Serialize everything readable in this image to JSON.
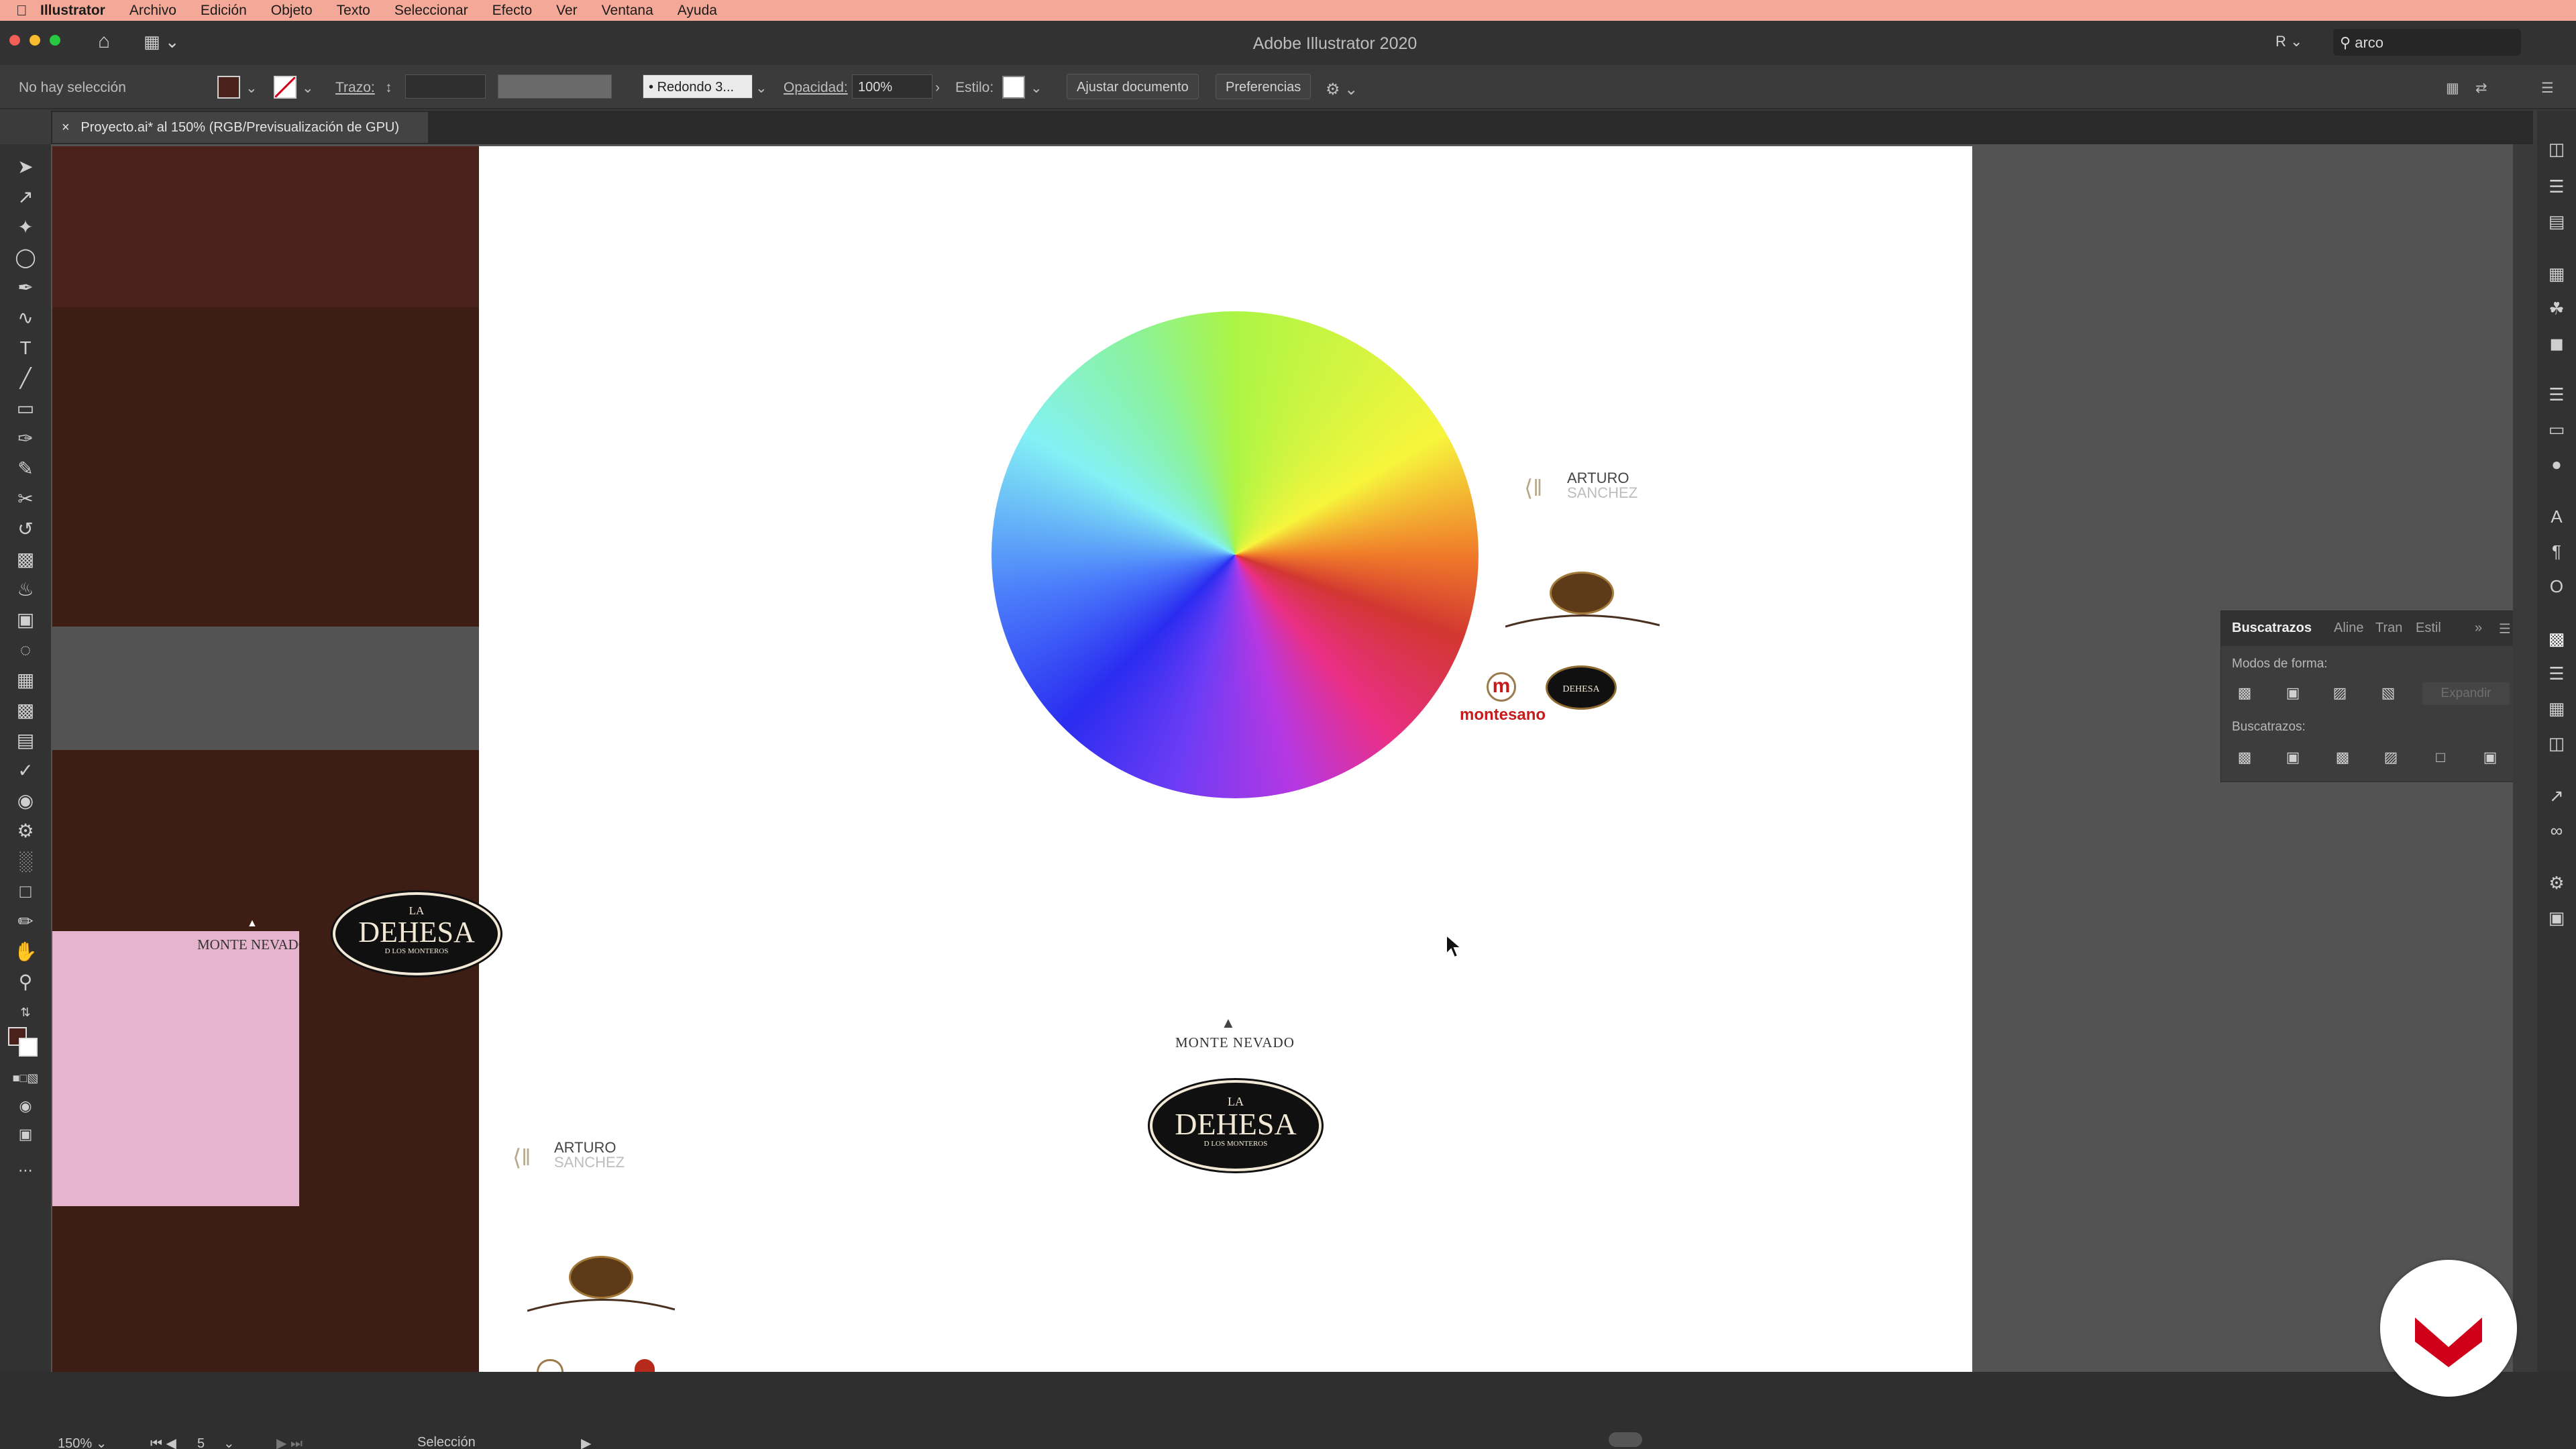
{
  "menubar": {
    "apple": "",
    "items": [
      "Illustrator",
      "Archivo",
      "Edición",
      "Objeto",
      "Texto",
      "Seleccionar",
      "Efecto",
      "Ver",
      "Ventana",
      "Ayuda"
    ]
  },
  "titlebar": {
    "title": "Adobe Illustrator 2020",
    "workspace": "R",
    "search_value": "arco"
  },
  "control_bar": {
    "selection": "No hay selección",
    "stroke_label": "Trazo:",
    "brush": "Redondo 3...",
    "opacity_label": "Opacidad:",
    "opacity_value": "100%",
    "style_label": "Estilo:",
    "fit_button": "Ajustar documento",
    "prefs_button": "Preferencias"
  },
  "document_tab": {
    "close": "×",
    "title": "Proyecto.ai* al 150% (RGB/Previsualización de GPU)"
  },
  "artwork": {
    "arturo_line1": "ARTURO",
    "arturo_line2": "SANCHEZ",
    "monte_nevado": "MONTE NEVADO",
    "dehesa_la": "LA",
    "dehesa_main": "DEHESA",
    "dehesa_sub": "D LOS MONTEROS",
    "montesano": "montesano",
    "montesano_m": "m"
  },
  "panel": {
    "tabs": [
      "Buscatrazos",
      "Aline",
      "Tran",
      "Estil"
    ],
    "shape_modes_label": "Modos de forma:",
    "pathfinders_label": "Buscatrazos:",
    "expand_button": "Expandir"
  },
  "statusbar": {
    "zoom": "150%",
    "artboard": "5",
    "tool": "Selección"
  },
  "colors": {
    "menubar": "#f4a898",
    "app_bg": "#323232",
    "canvas": "#535353",
    "dark_brown": "#3e1d14",
    "pink": "#e6b4cf",
    "accent_red": "#d0001a"
  }
}
